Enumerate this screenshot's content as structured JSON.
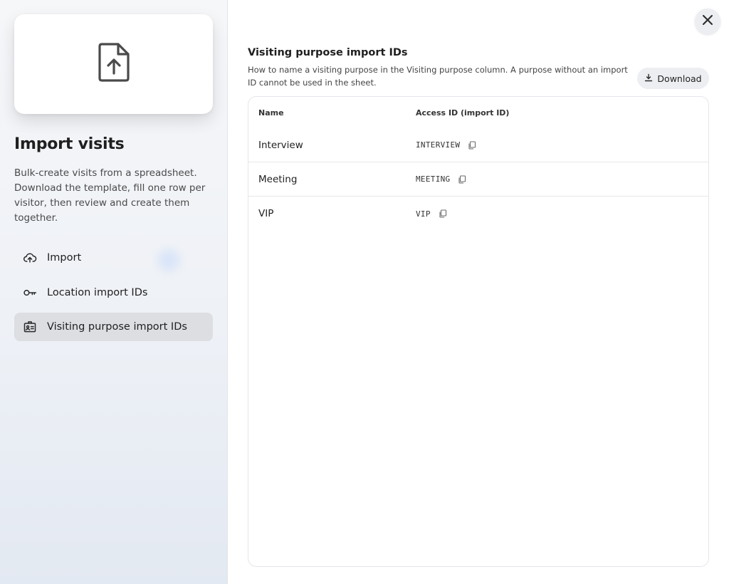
{
  "sidebar": {
    "hero_icon": "file-upload-icon",
    "title": "Import visits",
    "description": "Bulk-create visits from a spreadsheet. Download the template, fill one row per visitor, then review and create them together.",
    "items": [
      {
        "label": "Import",
        "icon": "cloud-upload-icon",
        "active": false
      },
      {
        "label": "Location import IDs",
        "icon": "key-icon",
        "active": false
      },
      {
        "label": "Visiting purpose import IDs",
        "icon": "id-badge-icon",
        "active": true
      }
    ]
  },
  "main": {
    "title": "Visiting purpose import IDs",
    "description": "How to name a visiting purpose in the Visiting purpose column. A purpose without an import ID cannot be used in the sheet.",
    "download_label": "Download",
    "table": {
      "columns": [
        "Name",
        "Access ID (import ID)"
      ],
      "rows": [
        {
          "name": "Interview",
          "id": "INTERVIEW"
        },
        {
          "name": "Meeting",
          "id": "MEETING"
        },
        {
          "name": "VIP",
          "id": "VIP"
        }
      ]
    }
  },
  "colors": {
    "active_nav_bg": "#dcdee2",
    "button_bg": "#eceef1",
    "border": "#e4e6ea"
  }
}
